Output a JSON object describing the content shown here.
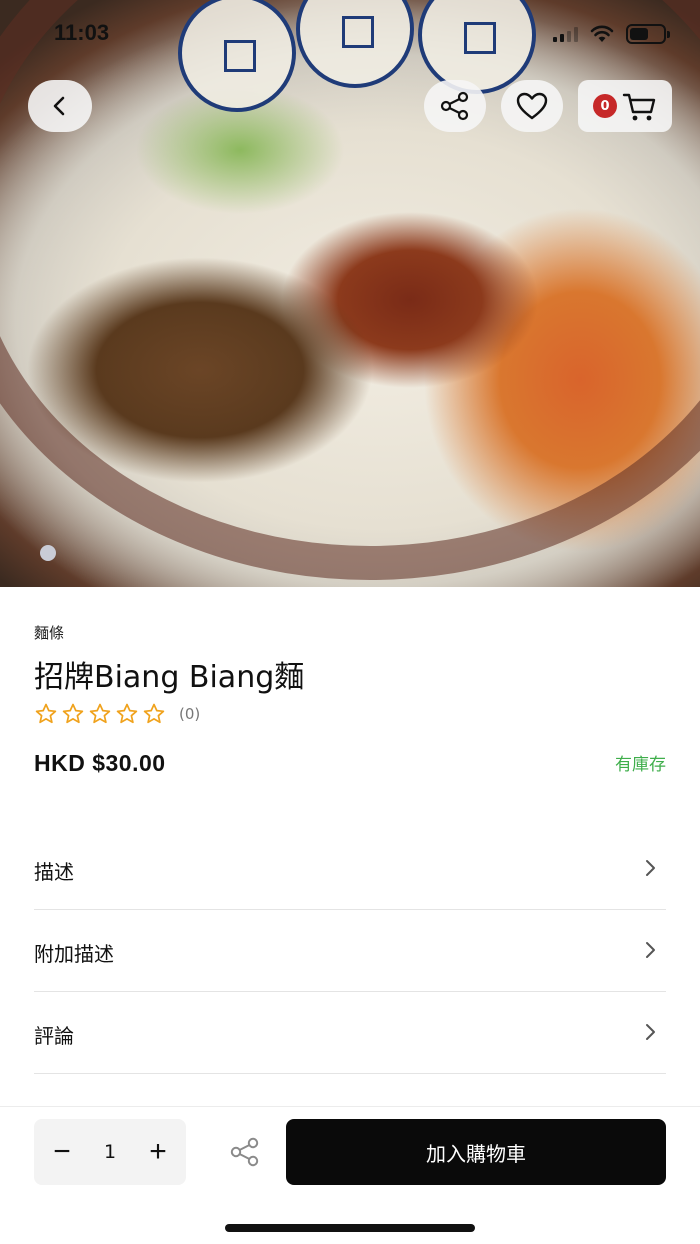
{
  "status_bar": {
    "time": "11:03"
  },
  "header": {
    "cart_count": "0",
    "icons": [
      "back-icon",
      "share-icon",
      "heart-icon",
      "cart-icon"
    ]
  },
  "product": {
    "category": "麵條",
    "title": "招牌Biang Biang麵",
    "rating_stars": 0,
    "rating_max": 5,
    "rating_count": "(0)",
    "price": "HKD $30.00",
    "stock_status": "有庫存"
  },
  "sections": [
    {
      "label": "描述"
    },
    {
      "label": "附加描述"
    },
    {
      "label": "評論"
    }
  ],
  "bottom_bar": {
    "quantity": "1",
    "minus": "−",
    "plus": "+",
    "add_to_cart": "加入購物車"
  },
  "colors": {
    "star": "#f0a21c",
    "stock": "#3fae4b",
    "badge": "#c62828",
    "primary_button": "#0a0a0a"
  }
}
